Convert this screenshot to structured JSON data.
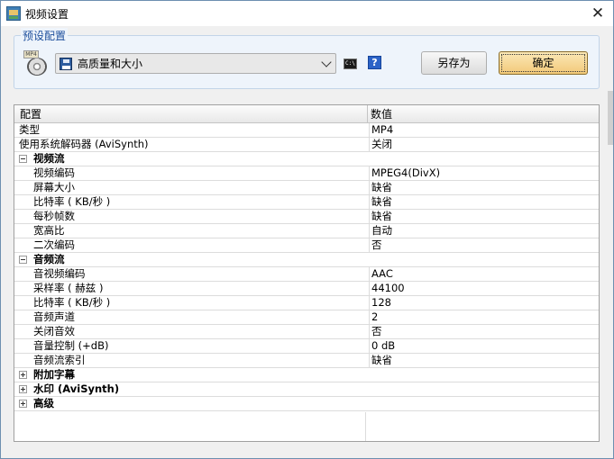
{
  "window": {
    "title": "视频设置",
    "close_glyph": "✕"
  },
  "preset": {
    "legend": "预设配置",
    "icon_tag": "MP4",
    "selected": "高质量和大小",
    "cmd_glyph": "C:\\",
    "help_glyph": "?",
    "save_as_label": "另存为",
    "ok_label": "确定"
  },
  "grid": {
    "header": {
      "name": "配置",
      "value": "数值"
    },
    "rows": [
      {
        "name": "类型",
        "value": "MP4"
      },
      {
        "name": "使用系统解码器 (AviSynth)",
        "value": "关闭"
      },
      {
        "name": "视频流",
        "value": ""
      },
      {
        "name": "视频编码",
        "value": "MPEG4(DivX)"
      },
      {
        "name": "屏幕大小",
        "value": "缺省"
      },
      {
        "name": "比特率 ( KB/秒 )",
        "value": "缺省"
      },
      {
        "name": "每秒帧数",
        "value": "缺省"
      },
      {
        "name": "宽高比",
        "value": "自动"
      },
      {
        "name": "二次编码",
        "value": "否"
      },
      {
        "name": "音频流",
        "value": ""
      },
      {
        "name": "音视频编码",
        "value": "AAC"
      },
      {
        "name": "采样率 ( 赫兹 )",
        "value": "44100"
      },
      {
        "name": "比特率 ( KB/秒 )",
        "value": "128"
      },
      {
        "name": "音频声道",
        "value": "2"
      },
      {
        "name": "关闭音效",
        "value": "否"
      },
      {
        "name": "音量控制 (+dB)",
        "value": "0 dB"
      },
      {
        "name": "音频流索引",
        "value": "缺省"
      },
      {
        "name": "附加字幕",
        "value": ""
      },
      {
        "name": "水印 (AviSynth)",
        "value": ""
      },
      {
        "name": "高级",
        "value": ""
      }
    ]
  },
  "colors": {
    "legend": "#1e4f9c",
    "ok_button": "#f2c979",
    "group_bg": "#eef4fb"
  }
}
